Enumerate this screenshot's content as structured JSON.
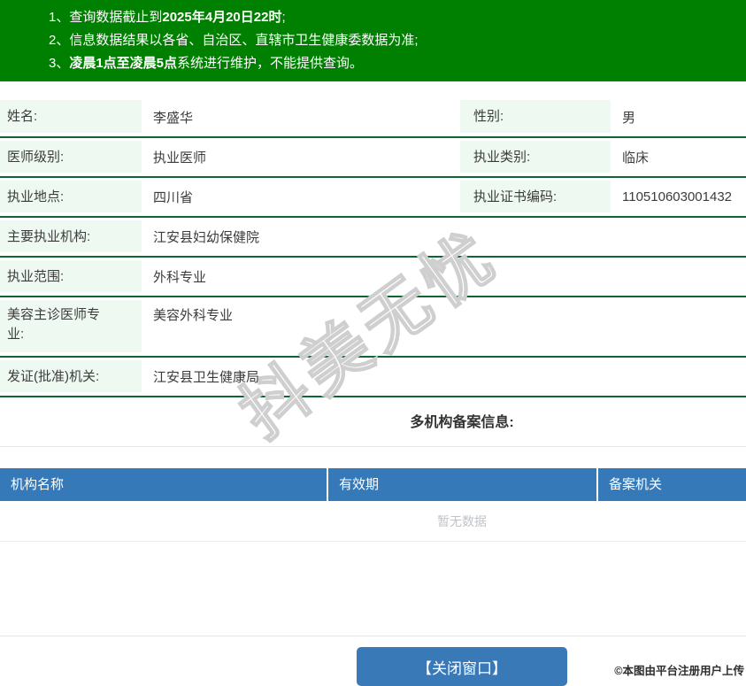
{
  "notice": {
    "items": [
      {
        "num": "1、",
        "pre": "查询数据截止到",
        "bold": "2025年4月20日22时",
        "post": ";"
      },
      {
        "num": "2、",
        "pre": "信息数据结果以各省、自治区、直辖市卫生健康委数据为准;",
        "bold": "",
        "post": ""
      },
      {
        "num": "3、",
        "pre": "",
        "bold": "凌晨1点至凌晨5点",
        "post": "系统进行维护，不能提供查询。"
      }
    ]
  },
  "info": {
    "rows": [
      {
        "cells": [
          {
            "label": "姓名:",
            "value": "李盛华"
          },
          {
            "label": "性别:",
            "value": "男"
          }
        ]
      },
      {
        "cells": [
          {
            "label": "医师级别:",
            "value": "执业医师"
          },
          {
            "label": "执业类别:",
            "value": "临床"
          }
        ]
      },
      {
        "cells": [
          {
            "label": "执业地点:",
            "value": "四川省"
          },
          {
            "label": "执业证书编码:",
            "value": "110510603001432"
          }
        ]
      },
      {
        "cells": [
          {
            "label": "主要执业机构:",
            "value": "江安县妇幼保健院"
          }
        ]
      },
      {
        "cells": [
          {
            "label": "执业范围:",
            "value": "外科专业"
          }
        ]
      },
      {
        "cells": [
          {
            "label": "美容主诊医师专业:",
            "value": "美容外科专业"
          }
        ]
      },
      {
        "cells": [
          {
            "label": "发证(批准)机关:",
            "value": "江安县卫生健康局"
          }
        ]
      }
    ]
  },
  "section": {
    "title": "多机构备案信息:"
  },
  "records": {
    "headers": [
      "机构名称",
      "有效期",
      "备案机关"
    ],
    "empty": "暂无数据"
  },
  "footer": {
    "close": "【关闭窗口】"
  },
  "overlay": {
    "watermark": "抖美无忧",
    "attribution": "©本图由平台注册用户上传"
  },
  "colors": {
    "notice_green": "#008000",
    "row_border_green": "#0c6634",
    "label_bg_mint": "#eef9f2",
    "table_header_blue": "#3579b8",
    "button_blue": "#3a79b8",
    "empty_text_grey": "#bfc3c9"
  }
}
